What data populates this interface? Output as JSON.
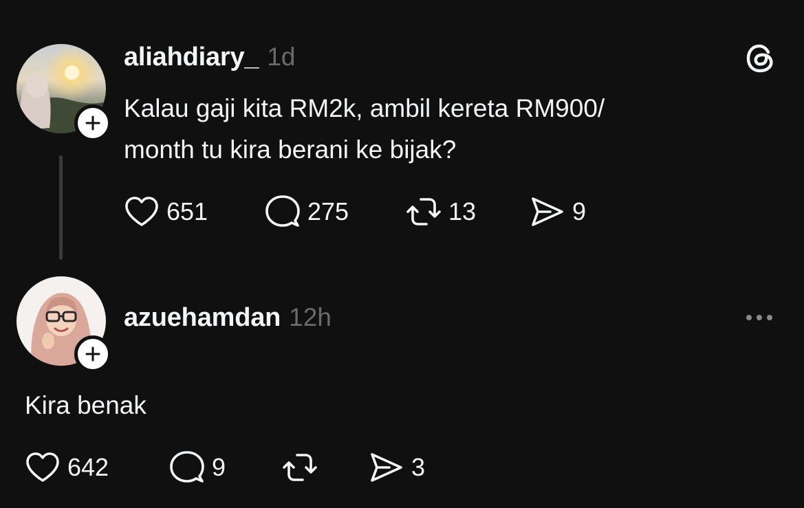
{
  "post": {
    "username": "aliahdiary_",
    "time": "1d",
    "text_line1": "Kalau gaji kita RM2k, ambil kereta RM900/",
    "text_line2": "month tu kira berani ke bijak?",
    "likes": "651",
    "comments": "275",
    "reposts": "13",
    "shares": "9"
  },
  "reply": {
    "username": "azuehamdan",
    "time": "12h",
    "text": "Kira benak",
    "likes": "642",
    "comments": "9",
    "reposts": "",
    "shares": "3"
  },
  "icons": {
    "app_logo": "threads-logo-icon",
    "follow": "plus-icon",
    "like": "heart-icon",
    "comment": "speech-bubble-icon",
    "repost": "repost-icon",
    "share": "send-icon",
    "more": "more-dots-icon"
  }
}
